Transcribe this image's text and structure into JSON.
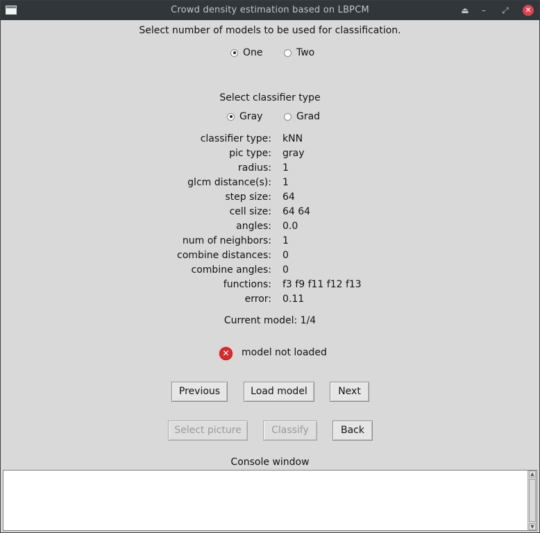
{
  "window": {
    "title": "Crowd density estimation based on LBPCM",
    "controls": {
      "shade": "⏏",
      "minimize": "–",
      "maximize": "⤢",
      "close": "✕"
    }
  },
  "models_prompt": "Select number of models to be used for classification.",
  "model_count": {
    "options": [
      {
        "label": "One",
        "selected": true
      },
      {
        "label": "Two",
        "selected": false
      }
    ]
  },
  "classifier_prompt": "Select classifier type",
  "classifier_type": {
    "options": [
      {
        "label": "Gray",
        "selected": true
      },
      {
        "label": "Grad",
        "selected": false
      }
    ]
  },
  "params": [
    {
      "key": "classifier type:",
      "value": "kNN"
    },
    {
      "key": "pic type:",
      "value": "gray"
    },
    {
      "key": "radius:",
      "value": "1"
    },
    {
      "key": "glcm distance(s):",
      "value": "1"
    },
    {
      "key": "step size:",
      "value": "64"
    },
    {
      "key": "cell size:",
      "value": "64 64"
    },
    {
      "key": "angles:",
      "value": "0.0"
    },
    {
      "key": "num of neighbors:",
      "value": "1"
    },
    {
      "key": "combine distances:",
      "value": "0"
    },
    {
      "key": "combine angles:",
      "value": "0"
    },
    {
      "key": "functions:",
      "value": "f3 f9 f11 f12 f13"
    },
    {
      "key": "error:",
      "value": "0.11"
    }
  ],
  "current_model": "Current model: 1/4",
  "status": {
    "icon": "error-icon",
    "glyph": "✕",
    "text": "model not loaded",
    "color": "#d32f2f"
  },
  "buttons": {
    "previous": "Previous",
    "load_model": "Load model",
    "next": "Next",
    "select_picture": "Select picture",
    "classify": "Classify",
    "back": "Back"
  },
  "console": {
    "label": "Console window",
    "text": ""
  },
  "colors": {
    "titlebar": "#31363b",
    "background": "#d9d9d9",
    "close_button": "#da4453"
  }
}
